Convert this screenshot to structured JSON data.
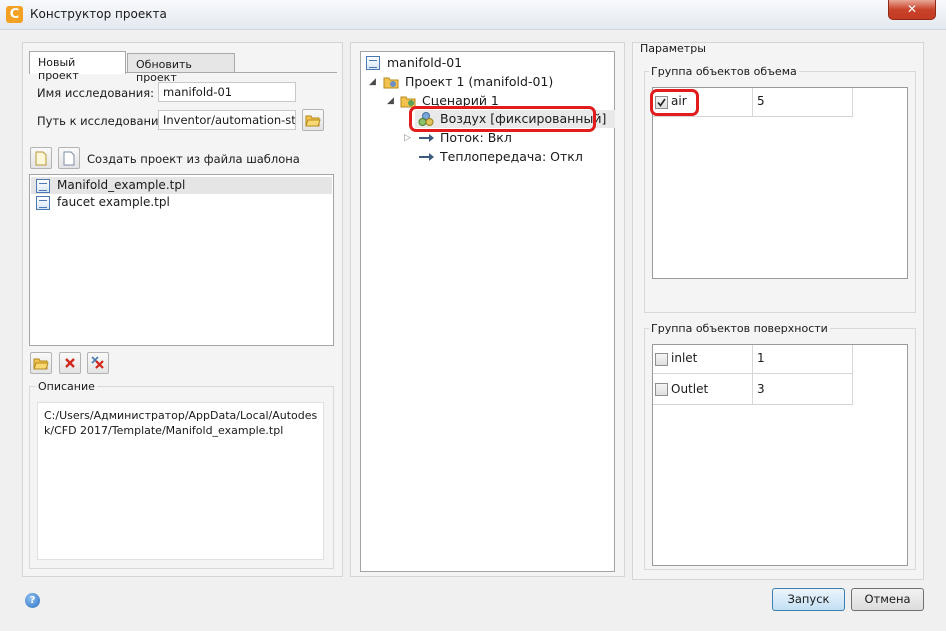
{
  "window": {
    "title": "Конструктор проекта",
    "close_label": "✕"
  },
  "tabs": [
    {
      "label": "Новый проект",
      "active": true
    },
    {
      "label": "Обновить проект",
      "active": false
    }
  ],
  "form": {
    "study_name_label": "Имя исследования:",
    "study_name_value": "manifold-01",
    "study_path_label": "Путь к исследованию:",
    "study_path_value": "Inventor/automation-study",
    "template_label": "Создать проект из файла шаблона"
  },
  "templates": [
    {
      "label": "Manifold_example.tpl",
      "selected": true
    },
    {
      "label": "faucet example.tpl",
      "selected": false
    }
  ],
  "description": {
    "title": "Описание",
    "text": "C:/Users/Администратор/AppData/Local/Autodesk/CFD 2017/Template/Manifold_example.tpl"
  },
  "tree": {
    "root": "manifold-01",
    "project": "Проект 1 (manifold-01)",
    "scenario": "Сценарий 1",
    "material": "Воздух [фиксированный]",
    "flow": "Поток: Вкл",
    "heat": "Теплопередача: Откл"
  },
  "params": {
    "title": "Параметры",
    "volume_group_title": "Группа объектов объема",
    "volume_rows": [
      {
        "name": "air",
        "value": "5",
        "checked": true
      }
    ],
    "surface_group_title": "Группа объектов поверхности",
    "surface_rows": [
      {
        "name": "inlet",
        "value": "1",
        "checked": false
      },
      {
        "name": "Outlet",
        "value": "3",
        "checked": false
      }
    ]
  },
  "buttons": {
    "run": "Запуск",
    "cancel": "Отмена"
  },
  "colors": {
    "highlight": "#e21c1c",
    "accent": "#3c7fb1"
  }
}
